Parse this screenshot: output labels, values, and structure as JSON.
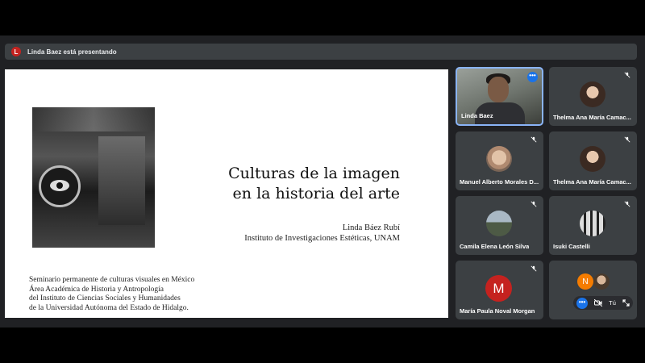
{
  "presenting": {
    "avatar_letter": "L",
    "text": "Linda Baez está presentando"
  },
  "slide": {
    "title_lines": [
      "Culturas de la imagen",
      "en la historia del arte"
    ],
    "author": "Linda Báez Rubí",
    "institute": "Instituto de Investigaciones Estéticas, UNAM",
    "footer_lines": [
      "Seminario permanente de culturas visuales en México",
      "Área Académica de Historia y Antropología",
      "del Instituto de Ciencias Sociales y Humanidades",
      "de la Universidad Autónoma del Estado de Hidalgo."
    ]
  },
  "participants": [
    {
      "name": "Linda Baez",
      "role": "speaker"
    },
    {
      "name": "Thelma Ana María Camac..."
    },
    {
      "name": "Manuel Alberto Morales D..."
    },
    {
      "name": "Thelma Ana María Camac..."
    },
    {
      "name": "Camila Elena León Silva"
    },
    {
      "name": "Isuki Castelli"
    },
    {
      "name": "María Paula Noval Morgan",
      "avatar_letter": "M"
    }
  ],
  "self_tile": {
    "avatar_letter": "N",
    "you_label": "Tú"
  },
  "icons": {
    "more": "more-options-icon",
    "mic_off": "mic-off-icon",
    "camera_off": "camera-off-icon",
    "expand": "expand-icon"
  },
  "colors": {
    "background": "#202124",
    "tile": "#3c4043",
    "active_border": "#8ab4f8",
    "accent": "#1a73e8",
    "red_avatar": "#c5221f",
    "orange_avatar": "#f57c00"
  }
}
